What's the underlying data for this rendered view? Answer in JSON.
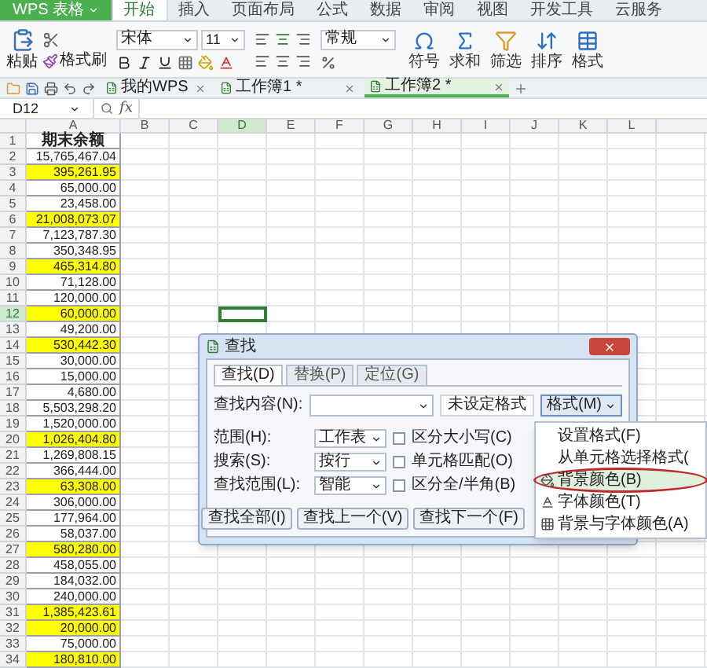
{
  "app_button": "WPS 表格",
  "ribbon_tabs": [
    {
      "label": "开始",
      "selected": true
    },
    {
      "label": "插入",
      "selected": false
    },
    {
      "label": "页面布局",
      "selected": false
    },
    {
      "label": "公式",
      "selected": false
    },
    {
      "label": "数据",
      "selected": false
    },
    {
      "label": "审阅",
      "selected": false
    },
    {
      "label": "视图",
      "selected": false
    },
    {
      "label": "开发工具",
      "selected": false
    },
    {
      "label": "云服务",
      "selected": false
    }
  ],
  "ribbon": {
    "paste": "粘贴",
    "format_painter": "格式刷",
    "font": "宋体",
    "font_size": "11",
    "number_format": "常规",
    "tools": [
      "符号",
      "求和",
      "筛选",
      "排序",
      "格式"
    ]
  },
  "doc_tabs": [
    {
      "label": "我的WPS",
      "selected": false
    },
    {
      "label": "工作簿1 *",
      "selected": false
    },
    {
      "label": "工作簿2 *",
      "selected": true
    }
  ],
  "name_box": "D12",
  "formula_label": "fx",
  "columns": [
    {
      "label": "A",
      "selected": false
    },
    {
      "label": "B",
      "selected": false
    },
    {
      "label": "C",
      "selected": false
    },
    {
      "label": "D",
      "selected": true
    },
    {
      "label": "E",
      "selected": false
    },
    {
      "label": "F",
      "selected": false
    },
    {
      "label": "G",
      "selected": false
    },
    {
      "label": "H",
      "selected": false
    },
    {
      "label": "I",
      "selected": false
    },
    {
      "label": "J",
      "selected": false
    },
    {
      "label": "K",
      "selected": false
    },
    {
      "label": "L",
      "selected": false
    }
  ],
  "rows": [
    {
      "number": "1",
      "value": "期末余额",
      "kind": "header",
      "highlighted": false,
      "selected": false
    },
    {
      "number": "2",
      "value": "15,765,467.04",
      "kind": "value",
      "highlighted": false,
      "selected": false
    },
    {
      "number": "3",
      "value": "395,261.95",
      "kind": "value",
      "highlighted": true,
      "selected": false
    },
    {
      "number": "4",
      "value": "65,000.00",
      "kind": "value",
      "highlighted": false,
      "selected": false
    },
    {
      "number": "5",
      "value": "23,458.00",
      "kind": "value",
      "highlighted": false,
      "selected": false
    },
    {
      "number": "6",
      "value": "21,008,073.07",
      "kind": "value",
      "highlighted": true,
      "selected": false
    },
    {
      "number": "7",
      "value": "7,123,787.30",
      "kind": "value",
      "highlighted": false,
      "selected": false
    },
    {
      "number": "8",
      "value": "350,348.95",
      "kind": "value",
      "highlighted": false,
      "selected": false
    },
    {
      "number": "9",
      "value": "465,314.80",
      "kind": "value",
      "highlighted": true,
      "selected": false
    },
    {
      "number": "10",
      "value": "71,128.00",
      "kind": "value",
      "highlighted": false,
      "selected": false
    },
    {
      "number": "11",
      "value": "120,000.00",
      "kind": "value",
      "highlighted": false,
      "selected": false
    },
    {
      "number": "12",
      "value": "60,000.00",
      "kind": "value",
      "highlighted": true,
      "selected": true
    },
    {
      "number": "13",
      "value": "49,200.00",
      "kind": "value",
      "highlighted": false,
      "selected": false
    },
    {
      "number": "14",
      "value": "530,442.30",
      "kind": "value",
      "highlighted": true,
      "selected": false
    },
    {
      "number": "15",
      "value": "30,000.00",
      "kind": "value",
      "highlighted": false,
      "selected": false
    },
    {
      "number": "16",
      "value": "15,000.00",
      "kind": "value",
      "highlighted": false,
      "selected": false
    },
    {
      "number": "17",
      "value": "4,680.00",
      "kind": "value",
      "highlighted": false,
      "selected": false
    },
    {
      "number": "18",
      "value": "5,503,298.20",
      "kind": "value",
      "highlighted": false,
      "selected": false
    },
    {
      "number": "19",
      "value": "1,520,000.00",
      "kind": "value",
      "highlighted": false,
      "selected": false
    },
    {
      "number": "20",
      "value": "1,026,404.80",
      "kind": "value",
      "highlighted": true,
      "selected": false
    },
    {
      "number": "21",
      "value": "1,269,808.15",
      "kind": "value",
      "highlighted": false,
      "selected": false
    },
    {
      "number": "22",
      "value": "366,444.00",
      "kind": "value",
      "highlighted": false,
      "selected": false
    },
    {
      "number": "23",
      "value": "63,308.00",
      "kind": "value",
      "highlighted": true,
      "selected": false
    },
    {
      "number": "24",
      "value": "306,000.00",
      "kind": "value",
      "highlighted": false,
      "selected": false
    },
    {
      "number": "25",
      "value": "177,964.00",
      "kind": "value",
      "highlighted": false,
      "selected": false
    },
    {
      "number": "26",
      "value": "58,037.00",
      "kind": "value",
      "highlighted": false,
      "selected": false
    },
    {
      "number": "27",
      "value": "580,280.00",
      "kind": "value",
      "highlighted": true,
      "selected": false
    },
    {
      "number": "28",
      "value": "458,055.00",
      "kind": "value",
      "highlighted": false,
      "selected": false
    },
    {
      "number": "29",
      "value": "184,032.00",
      "kind": "value",
      "highlighted": false,
      "selected": false
    },
    {
      "number": "30",
      "value": "240,000.00",
      "kind": "value",
      "highlighted": false,
      "selected": false
    },
    {
      "number": "31",
      "value": "1,385,423.61",
      "kind": "value",
      "highlighted": true,
      "selected": false
    },
    {
      "number": "32",
      "value": "20,000.00",
      "kind": "value",
      "highlighted": true,
      "selected": false
    },
    {
      "number": "33",
      "value": "75,000.00",
      "kind": "value",
      "highlighted": false,
      "selected": false
    },
    {
      "number": "34",
      "value": "180,810.00",
      "kind": "value",
      "highlighted": true,
      "selected": false
    }
  ],
  "find_dialog": {
    "title": "查找",
    "tabs": [
      {
        "label": "查找(D)",
        "selected": true
      },
      {
        "label": "替换(P)",
        "selected": false
      },
      {
        "label": "定位(G)",
        "selected": false
      }
    ],
    "find_what_label": "查找内容(N):",
    "format_status": "未设定格式",
    "format_button": "格式(M)",
    "options": [
      {
        "label": "范围(H):",
        "value": "工作表",
        "checkbox_label": "区分大小写(C)",
        "checked": false
      },
      {
        "label": "搜索(S):",
        "value": "按行",
        "checkbox_label": "单元格匹配(O)",
        "checked": false
      },
      {
        "label": "查找范围(L):",
        "value": "智能",
        "checkbox_label": "区分全/半角(B)",
        "checked": false
      }
    ],
    "buttons": [
      "查找全部(I)",
      "查找上一个(V)",
      "查找下一个(F)"
    ]
  },
  "format_menu": [
    {
      "label": "设置格式(F)",
      "kind": "plain",
      "selected": false
    },
    {
      "label": "从单元格选择格式(",
      "kind": "plain",
      "selected": false
    },
    {
      "label": "背景颜色(B)",
      "kind": "background",
      "selected": true
    },
    {
      "label": "字体颜色(T)",
      "kind": "font",
      "selected": false
    },
    {
      "label": "背景与字体颜色(A)",
      "kind": "both",
      "selected": false
    }
  ]
}
